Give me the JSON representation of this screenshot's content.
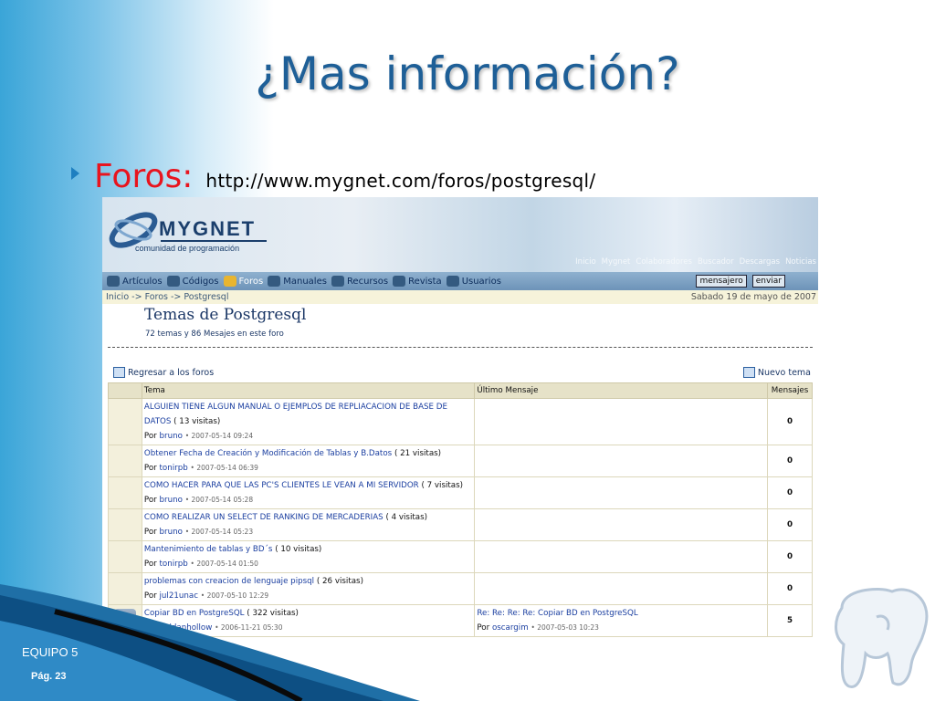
{
  "slide": {
    "title": "¿Mas información?",
    "bullet_label": "Foros:",
    "bullet_url": "http://www.mygnet.com/foros/postgresql/",
    "footer_team": "EQUIPO 5",
    "footer_page": "Pág. 23"
  },
  "site": {
    "logo": "MYGNET",
    "tagline": "comunidad de programación",
    "top_links": [
      "Inicio",
      "Mygnet",
      "Colaboradores",
      "Buscador",
      "Descargas",
      "Noticias"
    ],
    "nav": [
      {
        "label": "Artículos",
        "icon": "pencil-icon"
      },
      {
        "label": "Códigos",
        "icon": "code-icon"
      },
      {
        "label": "Foros",
        "icon": "forum-icon",
        "active": true
      },
      {
        "label": "Manuales",
        "icon": "manual-icon"
      },
      {
        "label": "Recursos",
        "icon": "resources-icon"
      },
      {
        "label": "Revista",
        "icon": "magazine-icon"
      },
      {
        "label": "Usuarios",
        "icon": "users-icon"
      }
    ],
    "mensajero": "mensajero",
    "enviar": "enviar",
    "breadcrumb": "Inicio -> Foros -> Postgresql",
    "date": "Sabado 19 de mayo de 2007",
    "forum_title": "Temas de Postgresql",
    "forum_stats": "72 temas y 86 Mesajes en este foro",
    "back_link": "Regresar a los foros",
    "new_topic": "Nuevo tema",
    "columns": {
      "tema": "Tema",
      "ultimo": "Último Mensaje",
      "mensajes": "Mensajes"
    },
    "topics": [
      {
        "title": "ALGUIEN TIENE ALGUN MANUAL O EJEMPLOS DE REPLIACACION DE BASE DE DATOS",
        "visits": "( 13 visitas)",
        "by": "Por",
        "user": "bruno",
        "date": "• 2007-05-14 09:24",
        "last": "",
        "last_by": "",
        "last_user": "",
        "last_date": "",
        "count": "0"
      },
      {
        "title": "Obtener Fecha de Creación y Modificación de Tablas y B.Datos",
        "visits": "( 21 visitas)",
        "by": "Por",
        "user": "tonirpb",
        "date": "• 2007-05-14 06:39",
        "last": "",
        "last_by": "",
        "last_user": "",
        "last_date": "",
        "count": "0"
      },
      {
        "title": "COMO HACER PARA QUE LAS PC'S CLIENTES LE VEAN A MI SERVIDOR",
        "visits": "( 7 visitas)",
        "by": "Por",
        "user": "bruno",
        "date": "• 2007-05-14 05:28",
        "last": "",
        "last_by": "",
        "last_user": "",
        "last_date": "",
        "count": "0"
      },
      {
        "title": "COMO REALIZAR UN SELECT DE RANKING DE MERCADERIAS",
        "visits": "( 4 visitas)",
        "by": "Por",
        "user": "bruno",
        "date": "• 2007-05-14 05:23",
        "last": "",
        "last_by": "",
        "last_user": "",
        "last_date": "",
        "count": "0"
      },
      {
        "title": "Mantenimiento de tablas y BD´s",
        "visits": "( 10 visitas)",
        "by": "Por",
        "user": "tonirpb",
        "date": "• 2007-05-14 01:50",
        "last": "",
        "last_by": "",
        "last_user": "",
        "last_date": "",
        "count": "0"
      },
      {
        "title": "problemas con creacion de lenguaje pipsql",
        "visits": "( 26 visitas)",
        "by": "Por",
        "user": "jul21unac",
        "date": "• 2007-05-10 12:29",
        "last": "",
        "last_by": "",
        "last_user": "",
        "last_date": "",
        "count": "0"
      },
      {
        "title": "Copiar BD en PostgreSQL",
        "visits": "( 322 visitas)",
        "by": "Por",
        "user": "Roldanhollow",
        "date": "• 2006-11-21 05:30",
        "last": "Re: Re: Re: Re: Copiar BD en PostgreSQL",
        "last_by": "Por",
        "last_user": "oscargim",
        "last_date": "• 2007-05-03 10:23",
        "count": "5"
      }
    ]
  }
}
